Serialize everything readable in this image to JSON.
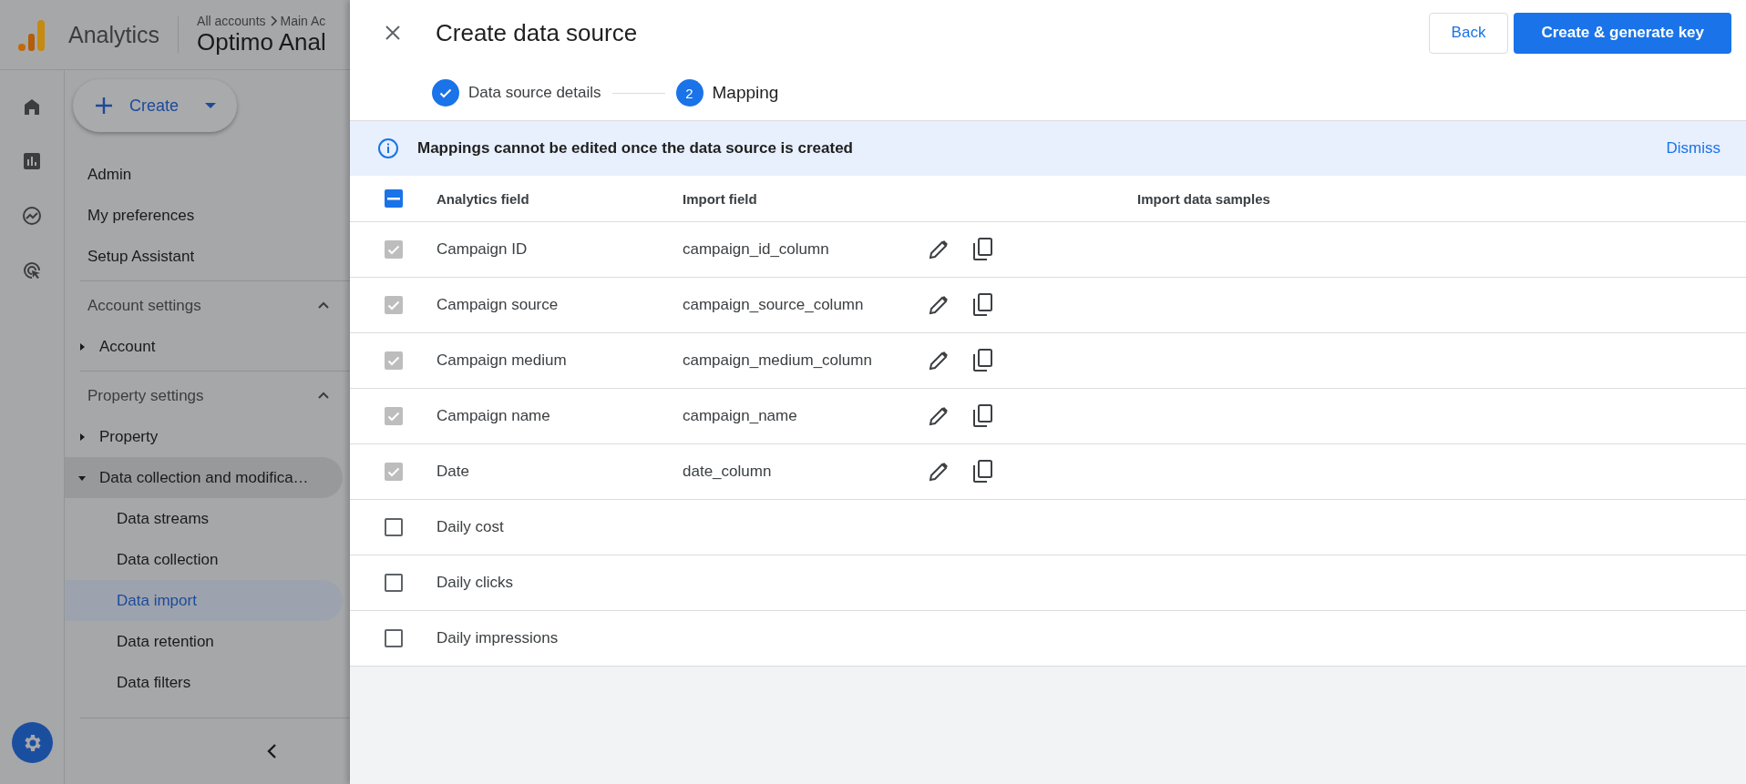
{
  "header": {
    "product": "Analytics",
    "breadcrumb": [
      "All accounts",
      "Main Ac"
    ],
    "property": "Optimo Anal"
  },
  "rail": [
    {
      "kind": "home",
      "selected": false
    },
    {
      "kind": "reports",
      "selected": false
    },
    {
      "kind": "explore",
      "selected": false
    },
    {
      "kind": "advertising",
      "selected": false
    }
  ],
  "settings_button": {
    "selected": true
  },
  "create_button": {
    "label": "Create"
  },
  "nav": [
    {
      "kind": "link",
      "label": "Admin"
    },
    {
      "kind": "link",
      "label": "My preferences"
    },
    {
      "kind": "link",
      "label": "Setup Assistant"
    },
    {
      "kind": "section",
      "label": "Account settings",
      "expanded": true
    },
    {
      "kind": "tree",
      "label": "Account",
      "expanded": false
    },
    {
      "kind": "section",
      "label": "Property settings",
      "expanded": true
    },
    {
      "kind": "tree",
      "label": "Property",
      "expanded": false
    },
    {
      "kind": "tree",
      "label": "Data collection and modifica…",
      "expanded": true,
      "children": [
        {
          "label": "Data streams",
          "selected": false
        },
        {
          "label": "Data collection",
          "selected": false
        },
        {
          "label": "Data import",
          "selected": true
        },
        {
          "label": "Data retention",
          "selected": false
        },
        {
          "label": "Data filters",
          "selected": false
        }
      ]
    }
  ],
  "dialog": {
    "title": "Create data source",
    "back_button": "Back",
    "primary_button": "Create & generate key",
    "steps": [
      {
        "label": "Data source details",
        "completed": true,
        "current": false
      },
      {
        "label": "Mapping",
        "number": "2",
        "completed": false,
        "current": true
      }
    ],
    "banner": {
      "text": "Mappings cannot be edited once the data source is created",
      "action": "Dismiss"
    },
    "table": {
      "select_all": {
        "indeterminate": true
      },
      "columns": [
        "Analytics field",
        "Import field",
        "Import data samples"
      ],
      "rows": [
        {
          "field": "Campaign ID",
          "import_field": "campaign_id_column",
          "checked": true,
          "disabled": true
        },
        {
          "field": "Campaign source",
          "import_field": "campaign_source_column",
          "checked": true,
          "disabled": true
        },
        {
          "field": "Campaign medium",
          "import_field": "campaign_medium_column",
          "checked": true,
          "disabled": true
        },
        {
          "field": "Campaign name",
          "import_field": "campaign_name",
          "checked": true,
          "disabled": true
        },
        {
          "field": "Date",
          "import_field": "date_column",
          "checked": true,
          "disabled": true
        },
        {
          "field": "Daily cost",
          "checked": false,
          "disabled": false
        },
        {
          "field": "Daily clicks",
          "checked": false,
          "disabled": false
        },
        {
          "field": "Daily impressions",
          "checked": false,
          "disabled": false
        }
      ]
    }
  }
}
